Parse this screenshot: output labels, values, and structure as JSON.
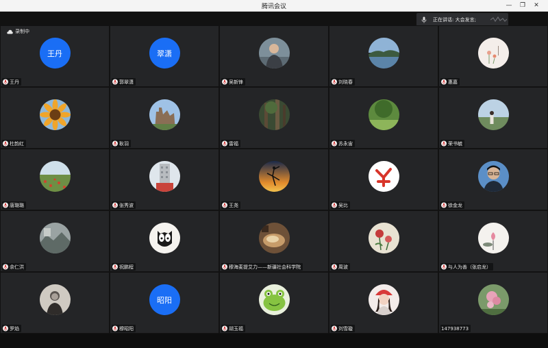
{
  "window": {
    "title": "腾讯会议"
  },
  "recording": {
    "label": "录制中"
  },
  "speaking": {
    "label": "正在讲话: 大会发言;"
  },
  "colors": {
    "accent": "#1a6ef5",
    "tile_bg": "#242527",
    "background": "#121212"
  },
  "participants": [
    {
      "name": "王丹",
      "avatar_text": "王丹"
    },
    {
      "name": "郭翠潇",
      "avatar_text": "翠潇"
    },
    {
      "name": "吴新锋",
      "avatar": "portrait-man"
    },
    {
      "name": "刘晓春",
      "avatar": "lake-landscape"
    },
    {
      "name": "惠嘉",
      "avatar": "flower-illustration"
    },
    {
      "name": "杜韵红",
      "avatar": "sunflower"
    },
    {
      "name": "耿羽",
      "avatar": "castle-ruins"
    },
    {
      "name": "雷福",
      "avatar": "forest-dark"
    },
    {
      "name": "苏永宙",
      "avatar": "green-field"
    },
    {
      "name": "荣书毓",
      "avatar": "person-outdoors"
    },
    {
      "name": "唐璐璐",
      "avatar": "poppy-field"
    },
    {
      "name": "张秀波",
      "avatar": "tall-building"
    },
    {
      "name": "王尧",
      "avatar": "dancer-sunset"
    },
    {
      "name": "吴比",
      "avatar": "red-logo"
    },
    {
      "name": "徐金龙",
      "avatar": "portrait-man-glasses"
    },
    {
      "name": "余仁洪",
      "avatar": "grey-landscape"
    },
    {
      "name": "祝鹏程",
      "avatar": "owl-drawing"
    },
    {
      "name": "穆海麦提艾力——新疆社会科学院",
      "avatar": "food-plate"
    },
    {
      "name": "周波",
      "avatar": "flower-painting"
    },
    {
      "name": "与人为善（张启龙）",
      "avatar": "lotus-ink"
    },
    {
      "name": "罗焰",
      "avatar": "woman-bw"
    },
    {
      "name": "穆昭阳",
      "avatar_text": "昭阳"
    },
    {
      "name": "胡玉福",
      "avatar": "frog-cartoon"
    },
    {
      "name": "刘雪璇",
      "avatar": "girl-red-hat"
    },
    {
      "name": "147938773",
      "avatar": "pink-flower",
      "no_mic": true
    }
  ]
}
